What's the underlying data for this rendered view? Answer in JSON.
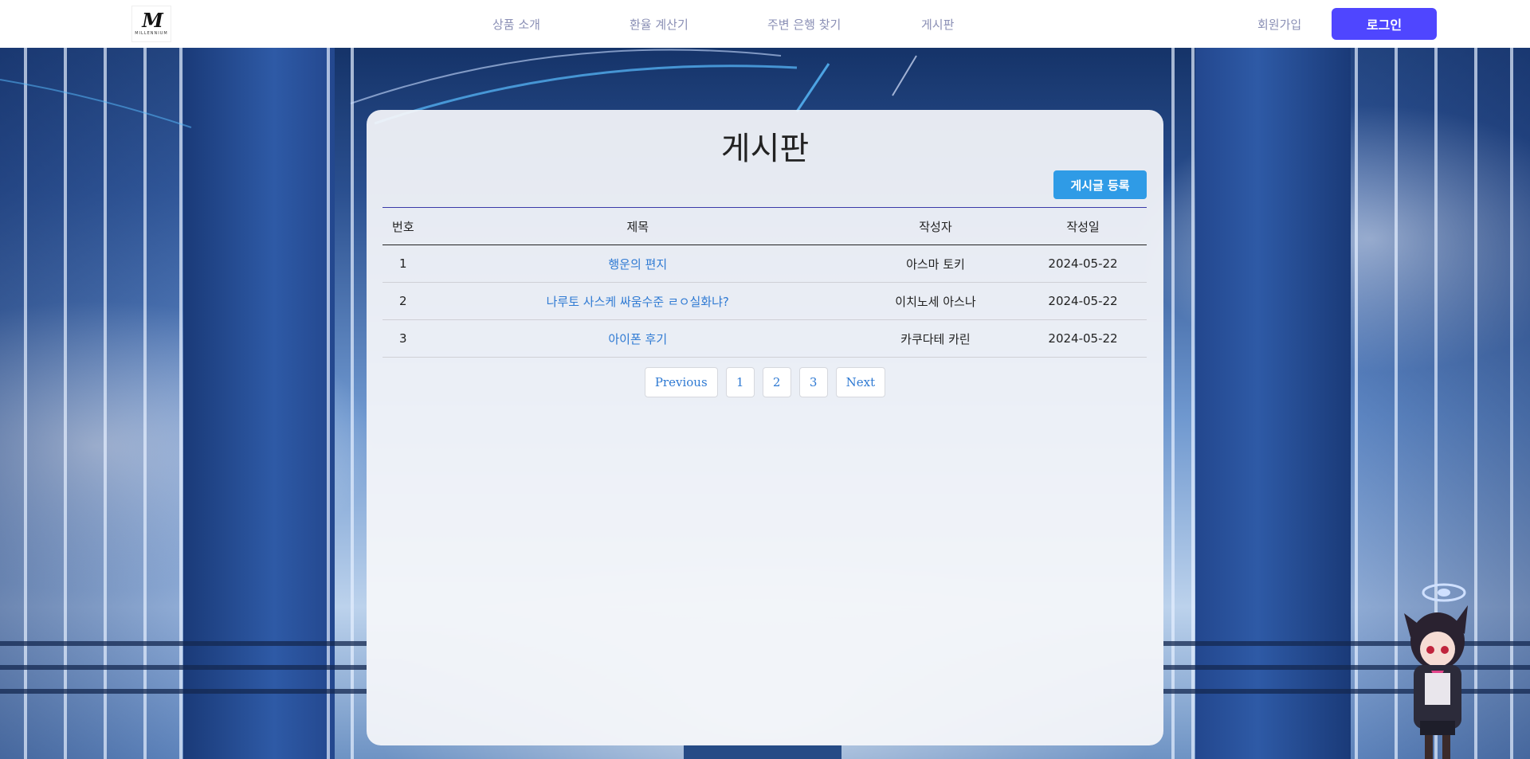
{
  "header": {
    "logo_text": "M",
    "logo_sub": "MILLENNIUM",
    "nav": [
      "상품 소개",
      "환율 계산기",
      "주변 은행 찾기",
      "게시판"
    ],
    "signup": "회원가입",
    "login": "로그인"
  },
  "board": {
    "title": "게시판",
    "write_button": "게시글 등록",
    "columns": [
      "번호",
      "제목",
      "작성자",
      "작성일"
    ],
    "rows": [
      {
        "no": "1",
        "title": "행운의 편지",
        "author": "아스마 토키",
        "date": "2024-05-22"
      },
      {
        "no": "2",
        "title": "나루토 사스케 싸움수준 ㄹㅇ실화냐?",
        "author": "이치노세 아스나",
        "date": "2024-05-22"
      },
      {
        "no": "3",
        "title": "아이폰 후기",
        "author": "카쿠다테 카린",
        "date": "2024-05-22"
      }
    ],
    "pagination": [
      "Previous",
      "1",
      "2",
      "3",
      "Next"
    ]
  },
  "colors": {
    "accent": "#4f46ff",
    "write_button": "#2f9be6",
    "link": "#2f7ad3",
    "nav_text": "#8a8fb5"
  }
}
